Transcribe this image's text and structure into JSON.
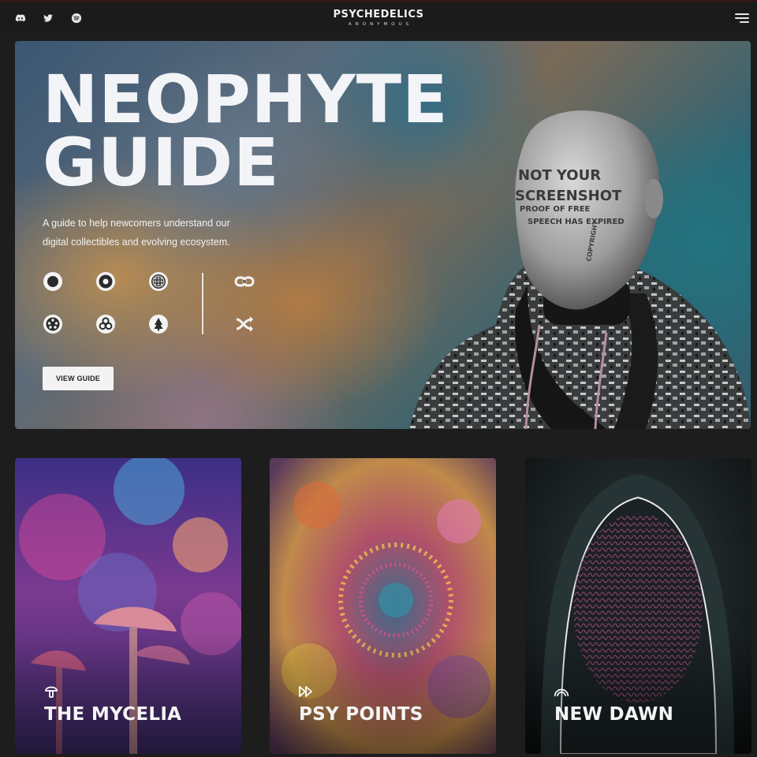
{
  "header": {
    "brand_name": "PSYCHEDELICS",
    "brand_sub": "ANONYMOUS",
    "social": [
      {
        "name": "discord-icon"
      },
      {
        "name": "twitter-icon"
      },
      {
        "name": "spotify-icon"
      }
    ],
    "menu_icon": "hamburger-menu-icon"
  },
  "hero": {
    "title_line1": "NEOPHYTE",
    "title_line2": "GUIDE",
    "description": "A guide to help newcomers understand our digital collectibles and evolving ecosystem.",
    "button_label": "VIEW GUIDE",
    "icons": [
      "ring-icon",
      "target-icon",
      "grid-circle-icon",
      "dotted-circle-icon",
      "trefoil-icon",
      "tree-icon",
      "link-icon",
      "shuffle-icon"
    ],
    "figure_text": [
      "NOT YOUR",
      "SCREENSHOT",
      "PROOF OF FREE",
      "SPEECH HAS EXPIRED",
      "COPYRIGHT"
    ]
  },
  "cards": [
    {
      "title": "THE MYCELIA",
      "icon": "mushroom-icon"
    },
    {
      "title": "PSY POINTS",
      "icon": "fast-forward-icon"
    },
    {
      "title": "NEW DAWN",
      "icon": "rainbow-arc-icon"
    }
  ],
  "colors": {
    "background": "#1d1d1e",
    "topbar": "#1b1b1c",
    "text": "#f3f4f7",
    "button_bg": "#f3f3f3"
  }
}
